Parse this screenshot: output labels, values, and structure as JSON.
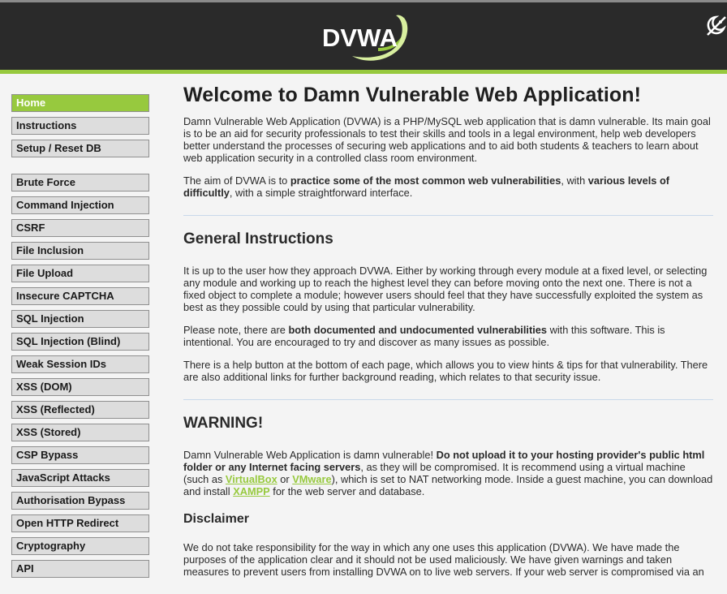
{
  "app": {
    "logo_text": "DVWA"
  },
  "menu": {
    "group1": [
      "Home",
      "Instructions",
      "Setup / Reset DB"
    ],
    "group2": [
      "Brute Force",
      "Command Injection",
      "CSRF",
      "File Inclusion",
      "File Upload",
      "Insecure CAPTCHA",
      "SQL Injection",
      "SQL Injection (Blind)",
      "Weak Session IDs",
      "XSS (DOM)",
      "XSS (Reflected)",
      "XSS (Stored)",
      "CSP Bypass",
      "JavaScript Attacks",
      "Authorisation Bypass",
      "Open HTTP Redirect",
      "Cryptography",
      "API"
    ],
    "selected": "Home"
  },
  "content": {
    "title": "Welcome to Damn Vulnerable Web Application!",
    "intro": "Damn Vulnerable Web Application (DVWA) is a PHP/MySQL web application that is damn vulnerable. Its main goal is to be an aid for security professionals to test their skills and tools in a legal environment, help web developers better understand the processes of securing web applications and to aid both students & teachers to learn about web application security in a controlled class room environment.",
    "aim": {
      "t1": "The aim of DVWA is to ",
      "b1": "practice some of the most common web vulnerabilities",
      "t2": ", with ",
      "b2": "various levels of difficultly",
      "t3": ", with a simple straightforward interface."
    },
    "general": {
      "heading": "General Instructions",
      "p1": "It is up to the user how they approach DVWA. Either by working through every module at a fixed level, or selecting any module and working up to reach the highest level they can before moving onto the next one. There is not a fixed object to complete a module; however users should feel that they have successfully exploited the system as best as they possible could by using that particular vulnerability.",
      "p2_t1": "Please note, there are ",
      "p2_b1": "both documented and undocumented vulnerabilities",
      "p2_t2": " with this software. This is intentional. You are encouraged to try and discover as many issues as possible.",
      "p3": "There is a help button at the bottom of each page, which allows you to view hints & tips for that vulnerability. There are also additional links for further background reading, which relates to that security issue."
    },
    "warning": {
      "heading": "WARNING!",
      "t1": "Damn Vulnerable Web Application is damn vulnerable! ",
      "b1": "Do not upload it to your hosting provider's public html folder or any Internet facing servers",
      "t2": ", as they will be compromised. It is recommend using a virtual machine (such as ",
      "link1": "VirtualBox",
      "t3": " or ",
      "link2": "VMware",
      "t4": "), which is set to NAT networking mode. Inside a guest machine, you can download and install ",
      "link3": "XAMPP",
      "t5": " for the web server and database."
    },
    "disclaimer": {
      "heading": "Disclaimer",
      "p1": "We do not take responsibility for the way in which any one uses this application (DVWA). We have made the purposes of the application clear and it should not be used maliciously. We have given warnings and taken measures to prevent users from installing DVWA on to live web servers. If your web server is compromised via an"
    }
  },
  "colors": {
    "accent": "#97c93e",
    "header_bg": "#2a2a2a",
    "page_bg": "#f4f4f4"
  }
}
